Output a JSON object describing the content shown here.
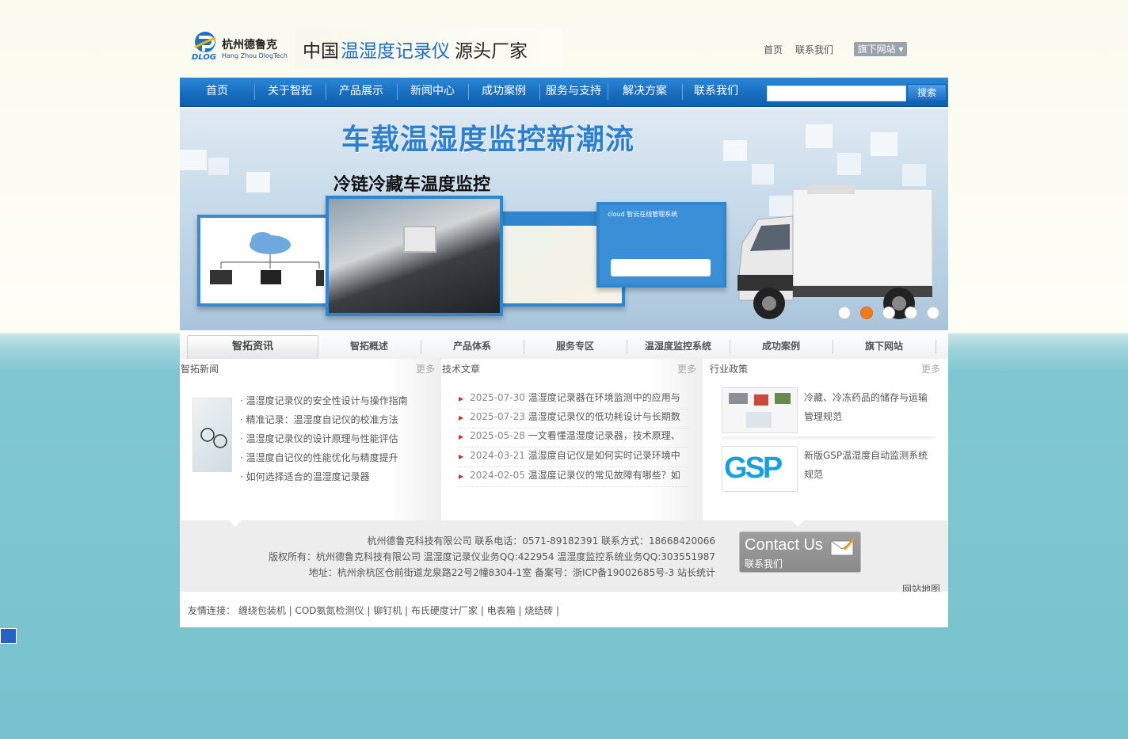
{
  "header": {
    "brand": "杭州德鲁克",
    "brand_en": "Hang Zhou DlogTech",
    "logo_text": "DLOG",
    "tagline_a": "中国",
    "tagline_b": "温湿度记录仪",
    "tagline_c": " 源头厂家",
    "top_links": [
      "首页",
      "联系我们"
    ],
    "sister_button": "旗下网站 ▾"
  },
  "nav": {
    "items": [
      "首页",
      "关于智拓",
      "产品展示",
      "新闻中心",
      "成功案例",
      "服务与支持",
      "解决方案",
      "联系我们"
    ],
    "search_placeholder": "",
    "search_button": "搜索"
  },
  "banner": {
    "title": "车载温湿度监控新潮流",
    "subtitle": "冷链冷藏车温度监控",
    "screen_title": "cloud 智云在线管理系统",
    "slides": 5,
    "active_slide": 2
  },
  "tabs": [
    "智拓资讯",
    "智拓概述",
    "产品体系",
    "服务专区",
    "温湿度监控系统",
    "成功案例",
    "旗下网站"
  ],
  "news": {
    "title": "智拓新闻",
    "more": "更多",
    "items": [
      "· 温湿度记录仪的安全性设计与操作指南",
      "· 精准记录：温湿度自记仪的校准方法",
      "· 温湿度记录仪的设计原理与性能评估",
      "· 温湿度自记仪的性能优化与精度提升",
      "· 如何选择适合的温湿度记录器"
    ]
  },
  "articles": {
    "title": "技术文章",
    "more": "更多",
    "items": [
      {
        "date": "2025-07-30",
        "text": "温湿度记录器在环境监测中的应用与"
      },
      {
        "date": "2025-07-23",
        "text": "温湿度记录仪的低功耗设计与长期数"
      },
      {
        "date": "2025-05-28",
        "text": "一文看懂温湿度记录器，技术原理、"
      },
      {
        "date": "2024-03-21",
        "text": "温湿度自记仪是如何实时记录环境中"
      },
      {
        "date": "2024-02-05",
        "text": "温湿度记录仪的常见故障有哪些？如"
      }
    ]
  },
  "policy": {
    "title": "行业政策",
    "more": "更多",
    "items": [
      {
        "line1": "冷藏、冷冻药品的储存与运输",
        "line2": "管理规范"
      },
      {
        "line1": "新版GSP温湿度自动监测系统",
        "line2": "规范"
      }
    ],
    "gsp_logo": "GSP"
  },
  "footer": {
    "line1": "杭州德鲁克科技有限公司 联系电话：0571-89182391 联系方式：18668420066",
    "line2": "版权所有：杭州德鲁克科技有限公司 温湿度记录仪业务QQ:422954 温湿度监控系统业务QQ:303551987",
    "line3": "地址：杭州余杭区仓前街道龙泉路22号2幢8304-1室 备案号：浙ICP备19002685号-3 站长统计",
    "contact_en": "Contact Us",
    "contact_cn": "联系我们",
    "sitemap": "网站地图"
  },
  "links": {
    "text": "友情连接：   缠绕包装机 | COD氨氮检测仪 | 铆钉机 | 布氏硬度计厂家 | 电表箱 | 烧结砖 |"
  },
  "colors": {
    "nav_blue": "#1a6fc0",
    "accent_orange": "#f07a20",
    "banner_title": "#2f7fd0"
  }
}
